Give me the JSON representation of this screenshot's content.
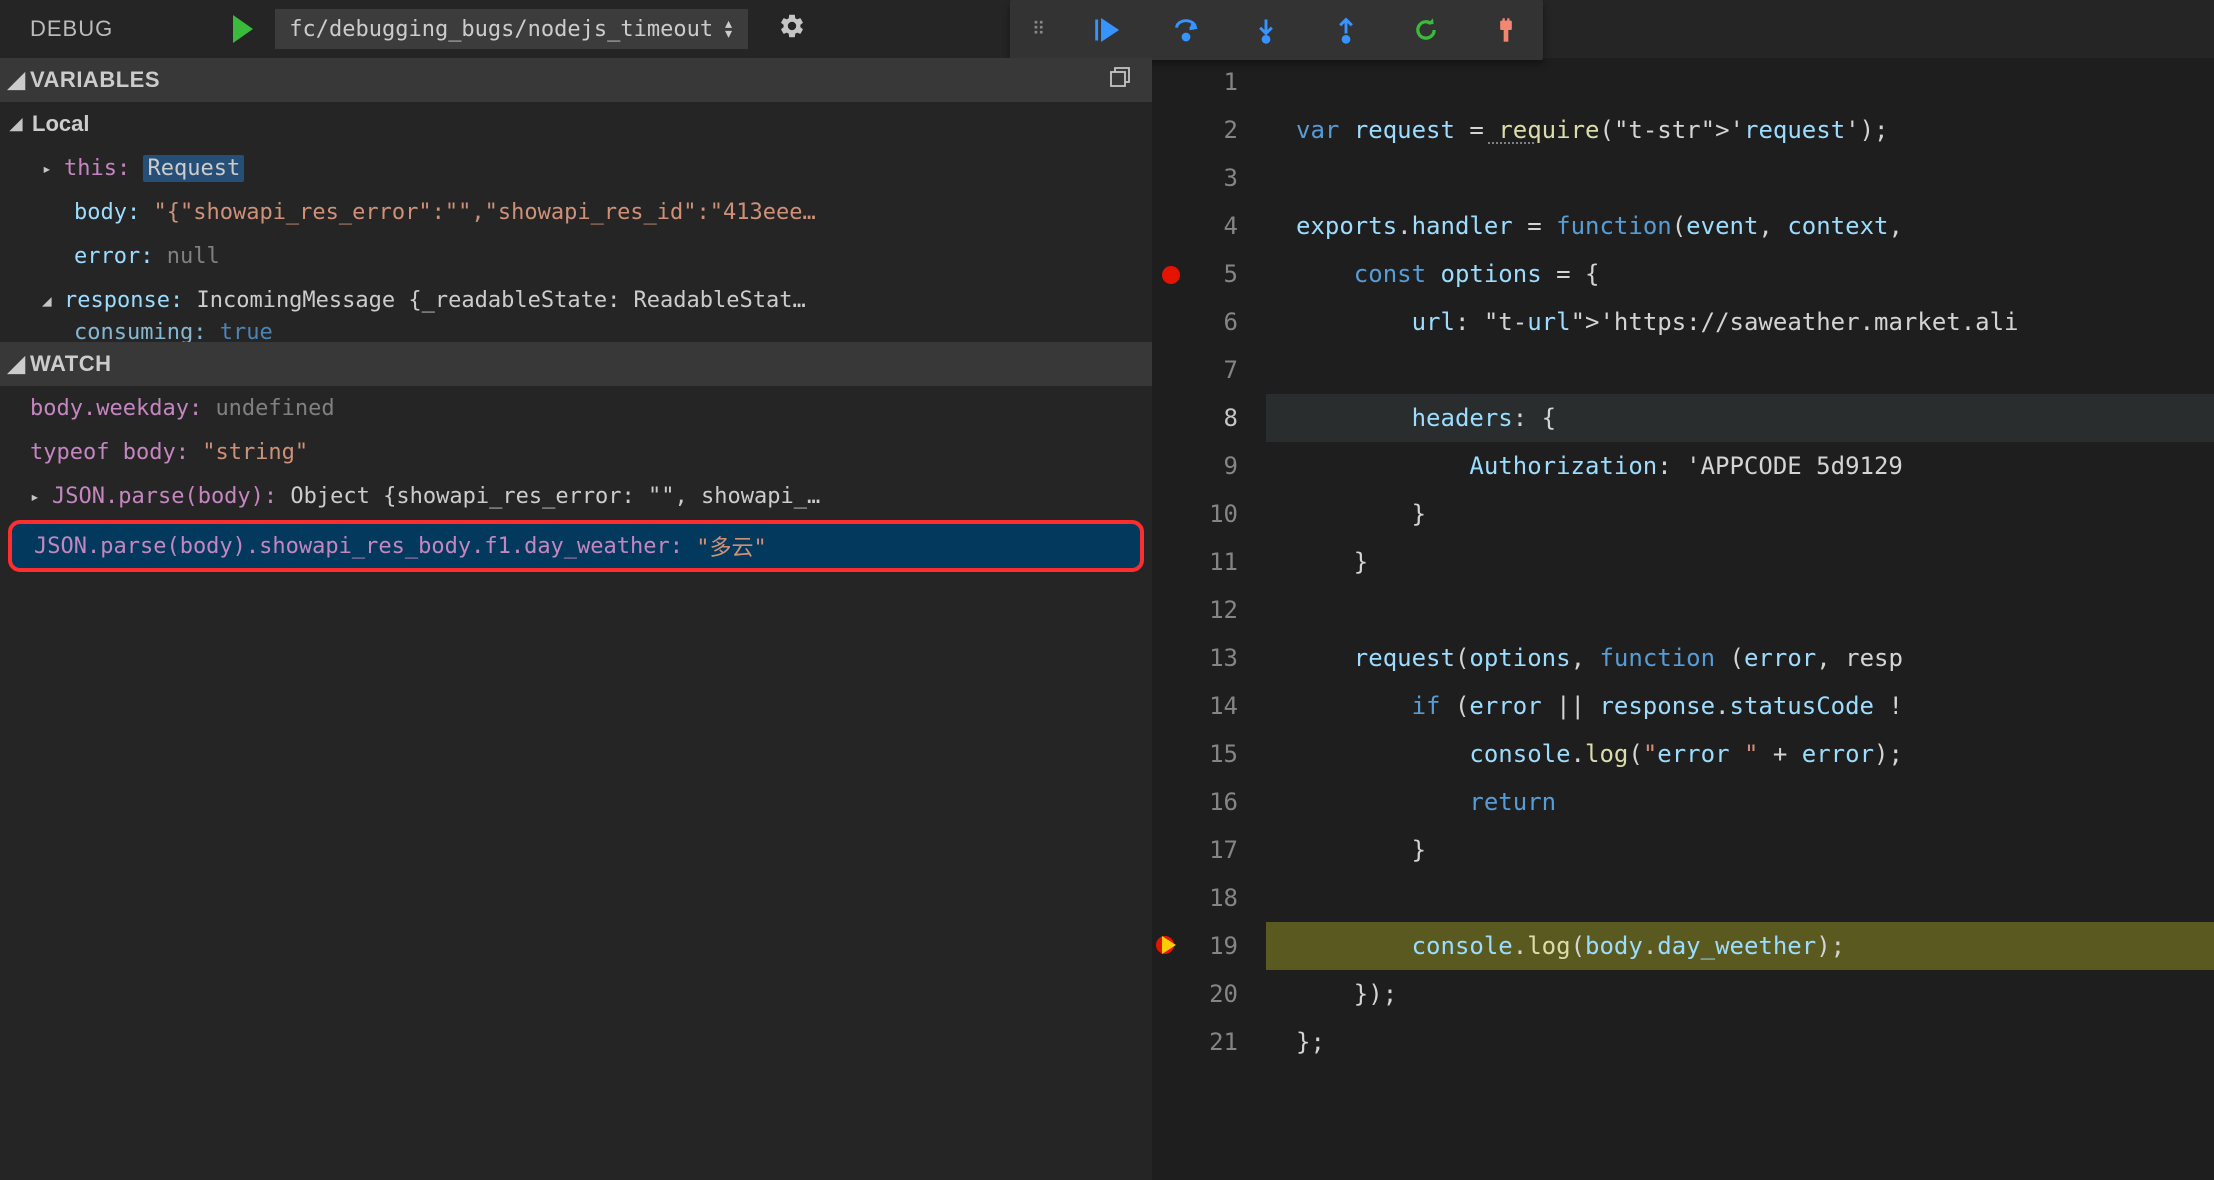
{
  "topbar": {
    "debug_label": "DEBUG",
    "config_name": "fc/debugging_bugs/nodejs_timeout"
  },
  "sections": {
    "variables_title": "VARIABLES",
    "watch_title": "WATCH",
    "local_label": "Local"
  },
  "variables": {
    "this_key": "this:",
    "this_val": "Request",
    "body_key": "body:",
    "body_val": "\"{\"showapi_res_error\":\"\",\"showapi_res_id\":\"413eee…",
    "error_key": "error:",
    "error_val": "null",
    "response_key": "response:",
    "response_val": "IncomingMessage {_readableState: ReadableStat…",
    "consuming_key": "consuming:",
    "consuming_val": "true"
  },
  "watch": [
    {
      "expr": "body.weekday:",
      "val": "undefined",
      "valClass": "k-null"
    },
    {
      "expr": "typeof body:",
      "val": "\"string\"",
      "valClass": "k-str"
    },
    {
      "expr": "JSON.parse(body):",
      "val": "Object {showapi_res_error: \"\", showapi_…",
      "valClass": "k-obj",
      "twisty": "▸"
    },
    {
      "expr": "JSON.parse(body).showapi_res_body.f1.day_weather:",
      "val": "\"多云\"",
      "valClass": "k-str",
      "selected": true
    }
  ],
  "editor": {
    "lines": [
      "",
      "var request = require('request');",
      "",
      "exports.handler = function(event, context,",
      "    const options = {",
      "        url: 'https://saweather.market.ali",
      "",
      "        headers: {",
      "            Authorization: 'APPCODE 5d9129",
      "        }",
      "    }",
      "",
      "    request(options, function (error, resp",
      "        if (error || response.statusCode !",
      "            console.log(\"error \" + error);",
      "            return",
      "        }",
      "",
      "        console.log(body.day_weether);",
      "    });",
      "};"
    ],
    "breakpoint_lines": [
      5
    ],
    "current_line": 19,
    "cursor_line": 8
  }
}
